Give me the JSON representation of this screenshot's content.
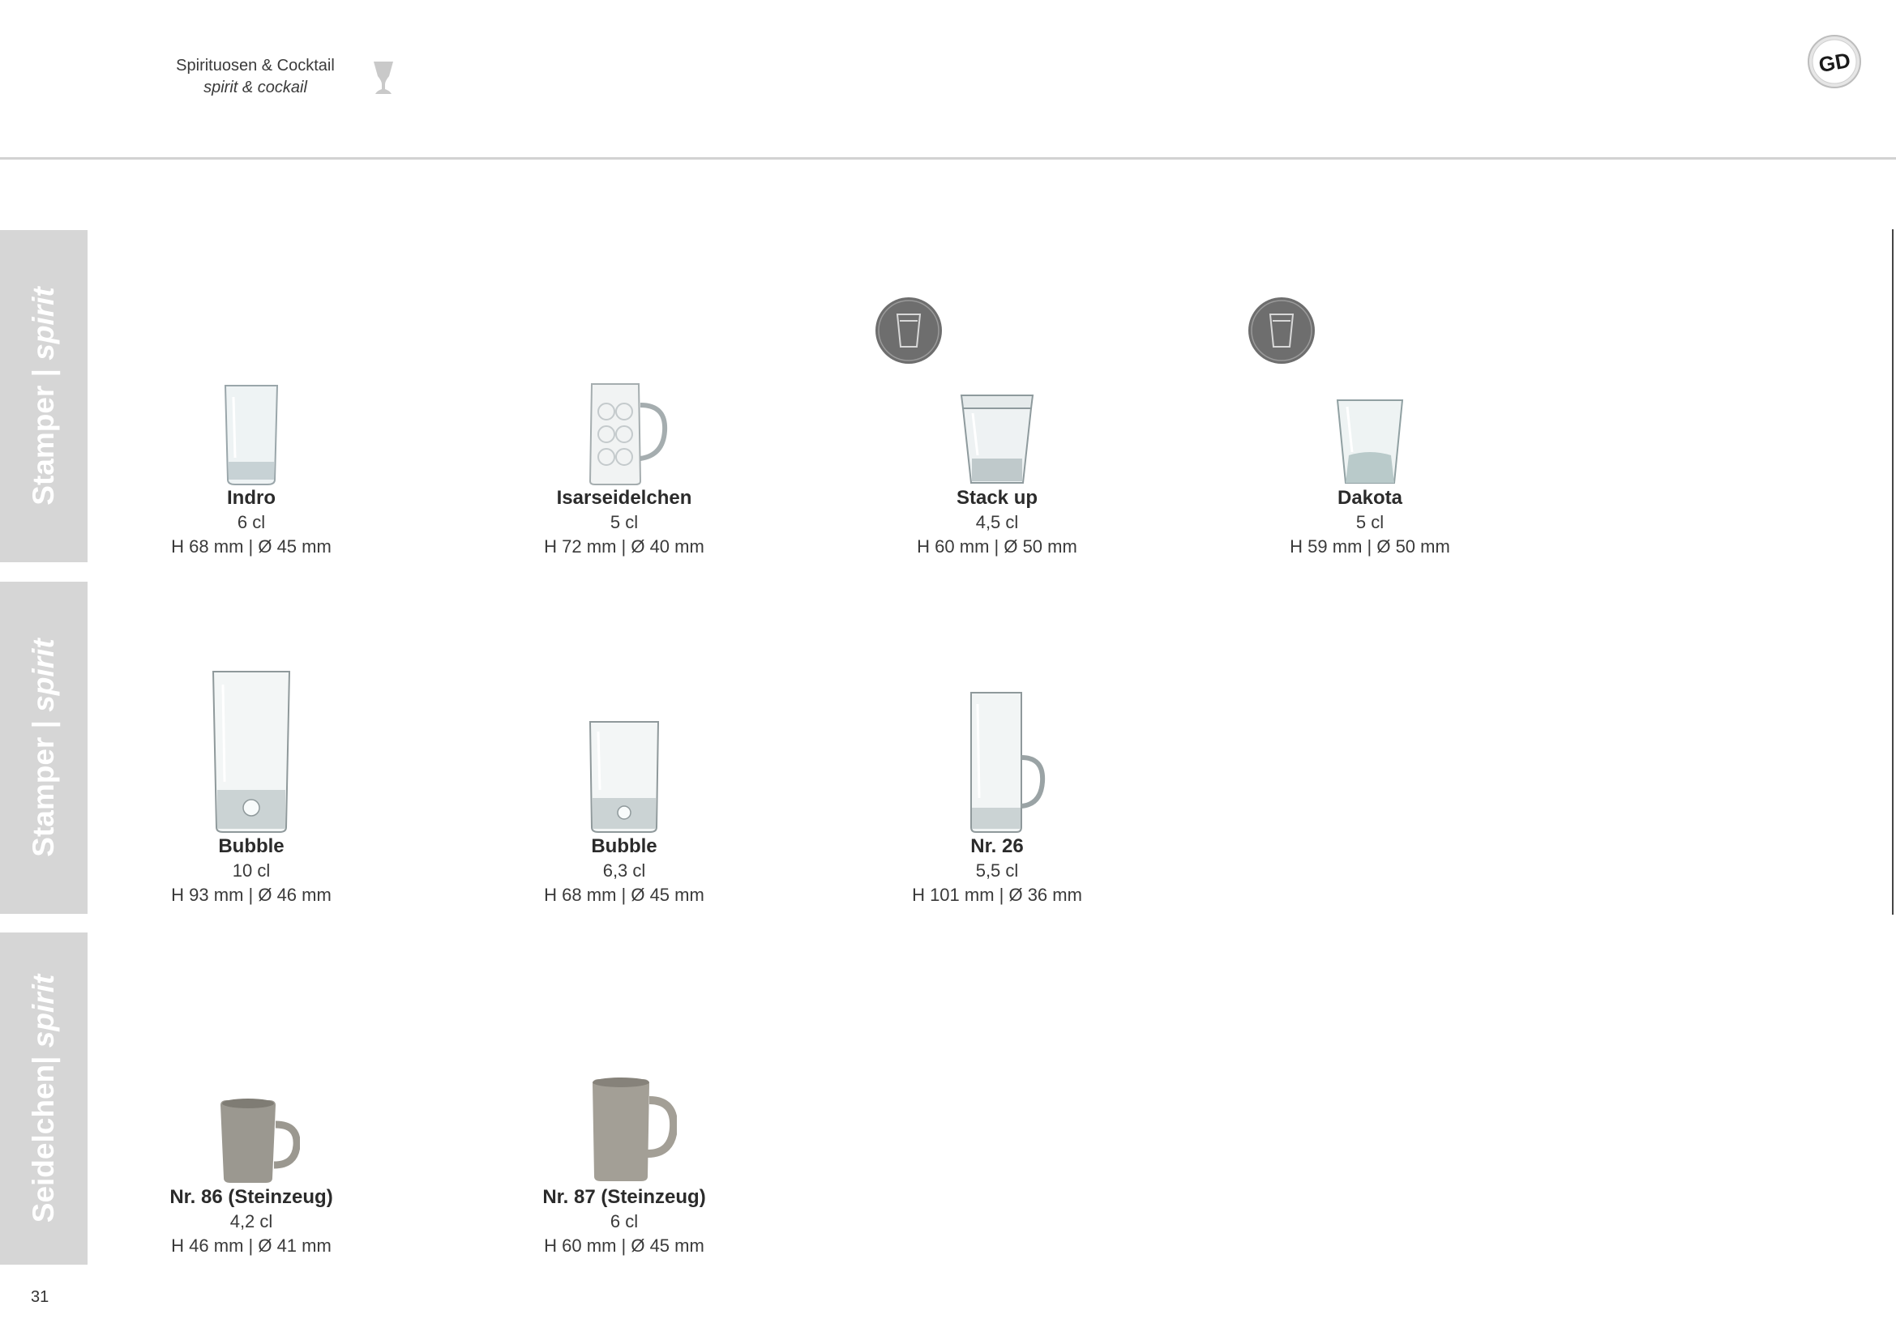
{
  "header": {
    "category_de": "Spirituosen & Cocktail",
    "category_en": "spirit & cockail",
    "category_icon": "stemmed-glass-icon",
    "brand_logo": "GD"
  },
  "tabs": [
    {
      "title": "Stamper | ",
      "title_italic": "spirit"
    },
    {
      "title": "Stamper | ",
      "title_italic": "spirit"
    },
    {
      "title": "Seidelchen| ",
      "title_italic": "spirit"
    }
  ],
  "badge_icon": "stackable-glass-icon",
  "products": [
    {
      "name": "Indro",
      "volume": "6 cl",
      "dims": "H 68 mm | Ø 45 mm"
    },
    {
      "name": "Isarseidelchen",
      "volume": "5 cl",
      "dims": "H 72 mm | Ø 40 mm"
    },
    {
      "name": "Stack up",
      "volume": "4,5 cl",
      "dims": "H 60 mm | Ø 50 mm"
    },
    {
      "name": "Dakota",
      "volume": "5 cl",
      "dims": "H 59 mm | Ø 50 mm"
    },
    {
      "name": "Bubble",
      "volume": "10 cl",
      "dims": "H 93 mm | Ø 46 mm"
    },
    {
      "name": "Bubble",
      "volume": "6,3 cl",
      "dims": "H 68 mm | Ø 45 mm"
    },
    {
      "name": "Nr. 26",
      "volume": "5,5 cl",
      "dims": "H 101 mm | Ø 36 mm"
    },
    {
      "name": "Nr. 86  (Steinzeug)",
      "volume": "4,2 cl",
      "dims": "H 46 mm | Ø 41 mm"
    },
    {
      "name": "Nr. 87  (Steinzeug)",
      "volume": "6 cl",
      "dims": "H 60 mm | Ø 45 mm"
    }
  ],
  "page_number": "31"
}
